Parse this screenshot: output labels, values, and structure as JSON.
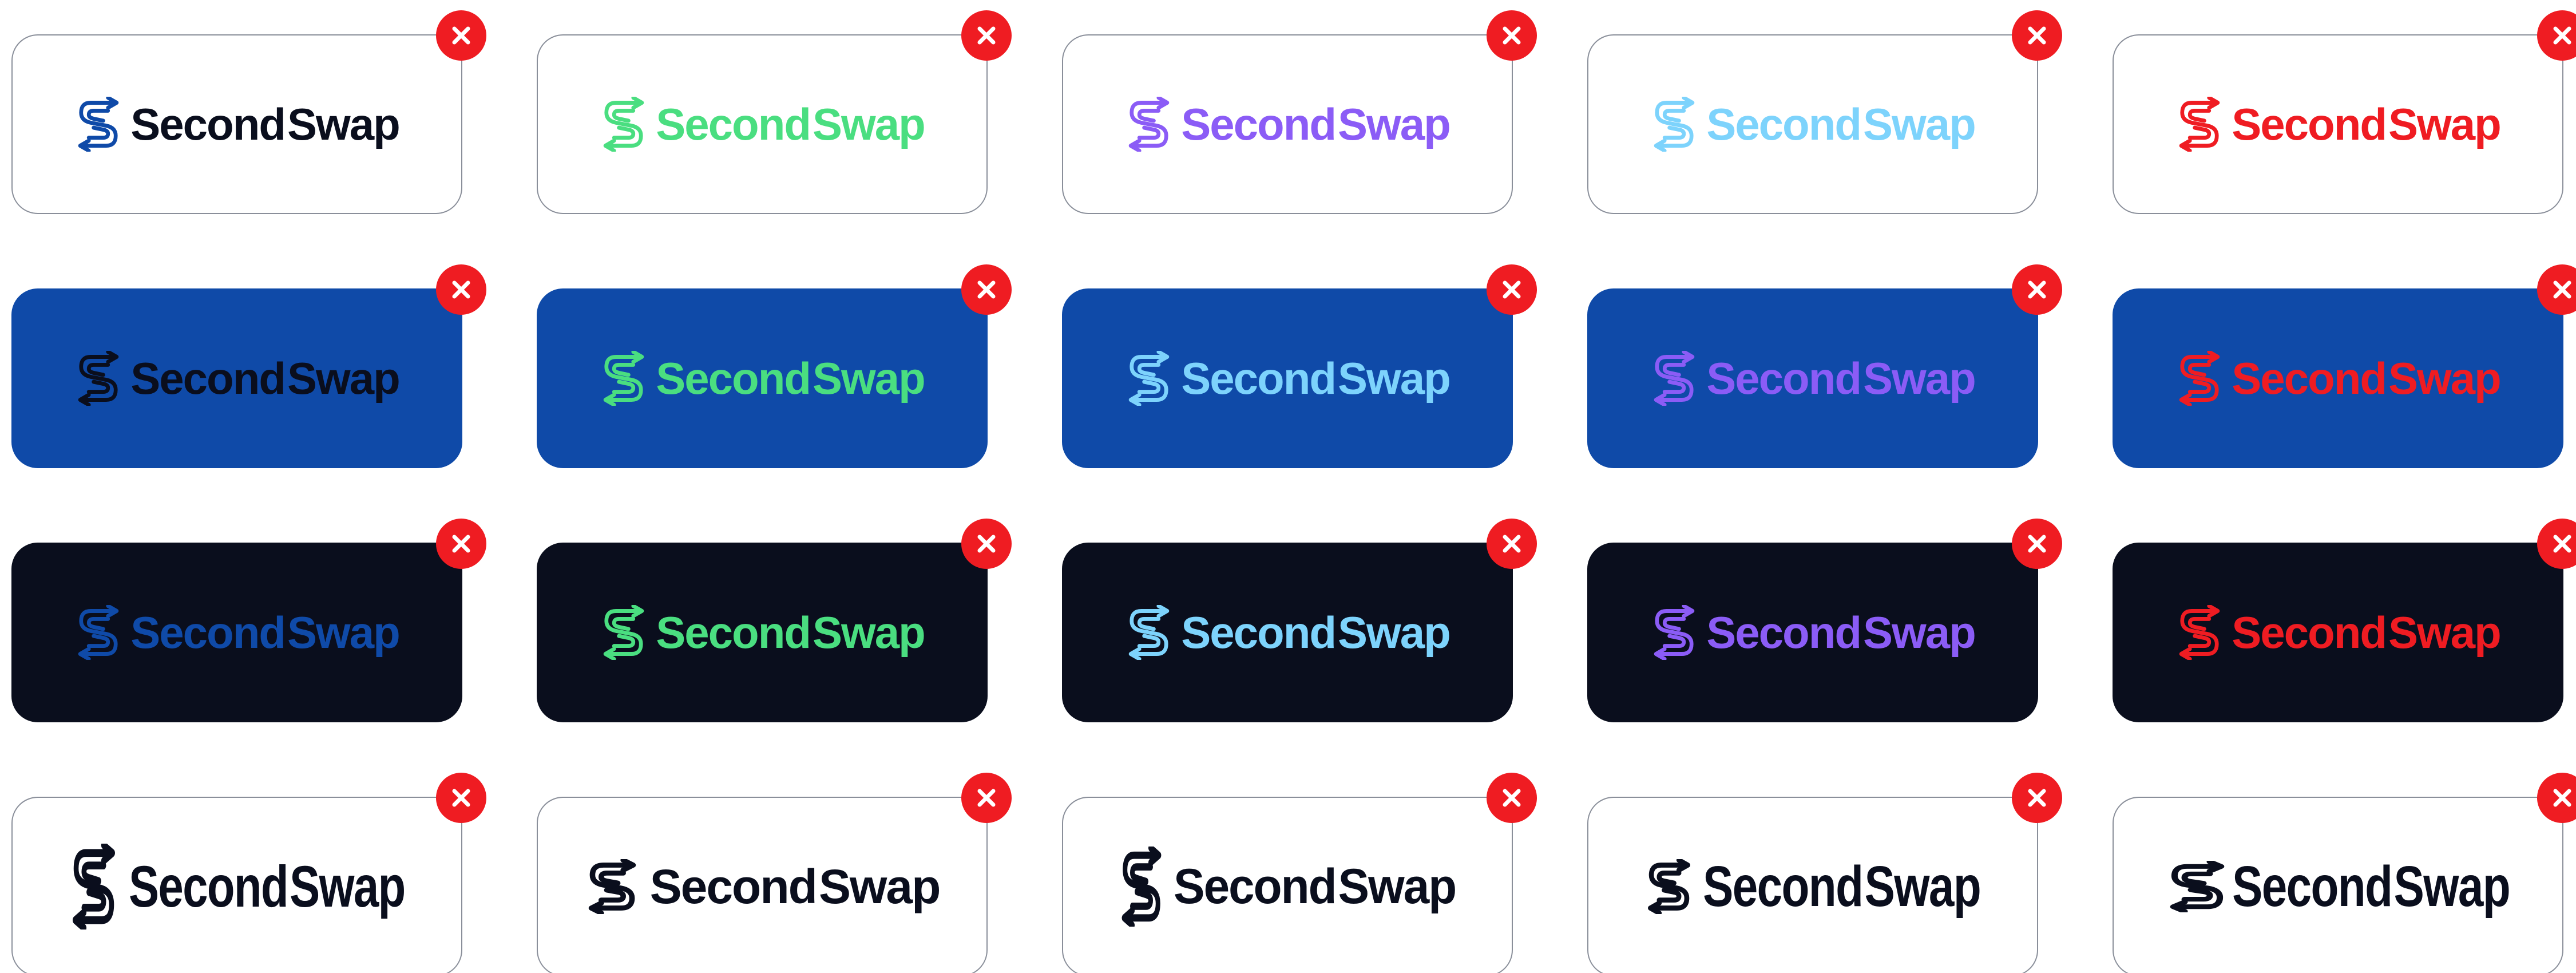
{
  "brand": {
    "word1": "Second",
    "word2": "Swap"
  },
  "icons": {
    "logo": "s-swap-arrows-icon",
    "close": "close-icon"
  },
  "colors": {
    "close_button": "#ef1c22",
    "backgrounds": {
      "white": "#ffffff",
      "blue": "#0f4aa8",
      "dark": "#0a0e1d"
    },
    "white_card_border": "#8a8f9a"
  },
  "rows": [
    {
      "background": "white",
      "style": "regular",
      "colors": [
        "#0f4aa8",
        "#4ade80",
        "#8b5cf6",
        "#7dd3fc",
        "#ef1c22"
      ],
      "text_colors": [
        "#0a0e1d",
        "#4ade80",
        "#8b5cf6",
        "#7dd3fc",
        "#ef1c22"
      ]
    },
    {
      "background": "blue",
      "style": "regular",
      "colors": [
        "#0a0e1d",
        "#4ade80",
        "#7dd3fc",
        "#8b5cf6",
        "#ef1c22"
      ],
      "text_colors": [
        "#0a0e1d",
        "#4ade80",
        "#7dd3fc",
        "#8b5cf6",
        "#ef1c22"
      ]
    },
    {
      "background": "dark",
      "style": "regular",
      "colors": [
        "#0f4aa8",
        "#4ade80",
        "#7dd3fc",
        "#8b5cf6",
        "#ef1c22"
      ],
      "text_colors": [
        "#0f4aa8",
        "#4ade80",
        "#7dd3fc",
        "#8b5cf6",
        "#ef1c22"
      ]
    },
    {
      "background": "white",
      "style": "condensed",
      "variants": [
        "tall-condensed",
        "italic-wide",
        "tall-wide",
        "small-condensed",
        "wide-icon-condensed"
      ],
      "colors": [
        "#0a0e1d",
        "#0a0e1d",
        "#0a0e1d",
        "#0a0e1d",
        "#0a0e1d"
      ],
      "text_colors": [
        "#0a0e1d",
        "#0a0e1d",
        "#0a0e1d",
        "#0a0e1d",
        "#0a0e1d"
      ]
    }
  ]
}
